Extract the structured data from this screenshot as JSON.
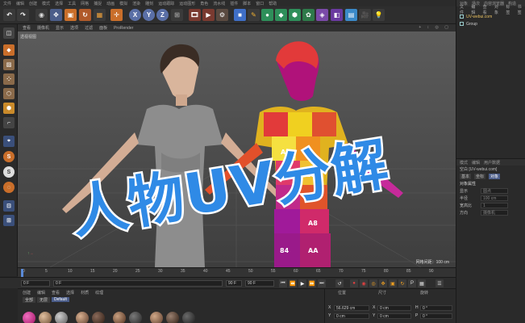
{
  "menu": [
    "文件",
    "编辑",
    "创建",
    "模式",
    "选择",
    "工具",
    "网格",
    "捕捉",
    "动画",
    "模拟",
    "渲染",
    "雕刻",
    "运动跟踪",
    "运动图形",
    "角色",
    "流水线",
    "插件",
    "脚本",
    "窗口",
    "帮助"
  ],
  "toolbar": {
    "axis_x": "X",
    "axis_y": "Y",
    "axis_z": "Z"
  },
  "viewport_menu": {
    "items": [
      "查看",
      "摄像机",
      "显示",
      "选项",
      "过滤",
      "面板",
      "ProRender"
    ],
    "right_icons": "+ ↕ ◎ ▢"
  },
  "viewport": {
    "label": "透视视图",
    "grid_note": "网格间距：100 cm",
    "uv_labels": [
      "AB",
      "AC",
      "BB",
      "BA",
      "A4",
      "84",
      "A8",
      "AA"
    ]
  },
  "timeline": {
    "ticks": [
      "0",
      "5",
      "10",
      "15",
      "20",
      "25",
      "30",
      "35",
      "40",
      "45",
      "50",
      "55",
      "60",
      "65",
      "70",
      "75",
      "80",
      "85",
      "90"
    ],
    "field_start": "0 F",
    "field_current": "0 F",
    "field_end": "90 F",
    "field_end2": "90 F"
  },
  "material": {
    "menu": [
      "创建",
      "编辑",
      "查看",
      "选择",
      "材质",
      "纹理"
    ],
    "tabs": [
      "全部",
      "无层",
      "Default"
    ]
  },
  "coordinates": {
    "headers": [
      "位置",
      "尺寸",
      "旋转"
    ],
    "rows": [
      {
        "axis": "X",
        "pos": "56.629 cm",
        "size": "0 cm",
        "rot_label": "H",
        "rot": "0 °"
      },
      {
        "axis": "Y",
        "pos": "0 cm",
        "size": "0 cm",
        "rot_label": "P",
        "rot": "0 °"
      }
    ]
  },
  "objects": {
    "tabs": [
      "对象",
      "场次",
      "内容浏览器",
      "构造"
    ],
    "menu": [
      "文件",
      "编辑",
      "查看",
      "对象",
      "标签",
      "书签"
    ],
    "items": [
      "UV-webui.com",
      "Group"
    ]
  },
  "attributes": {
    "tabs": [
      "模式",
      "编辑",
      "用户数据"
    ],
    "object_line": "空白 [UV-webui.com]",
    "subtabs": [
      "基本",
      "坐标",
      "对象"
    ],
    "section": "对象属性",
    "fields": [
      {
        "label": "显示",
        "value": "圆点"
      },
      {
        "label": "半径",
        "value": "100 cm"
      },
      {
        "label": "宽高比",
        "value": "1"
      },
      {
        "label": "方向",
        "value": "摄像机"
      }
    ]
  },
  "overlay": {
    "title": "人物UV分解"
  },
  "colors": {
    "accent": "#4b5d8a",
    "title_blue": "#2f8ae6"
  }
}
